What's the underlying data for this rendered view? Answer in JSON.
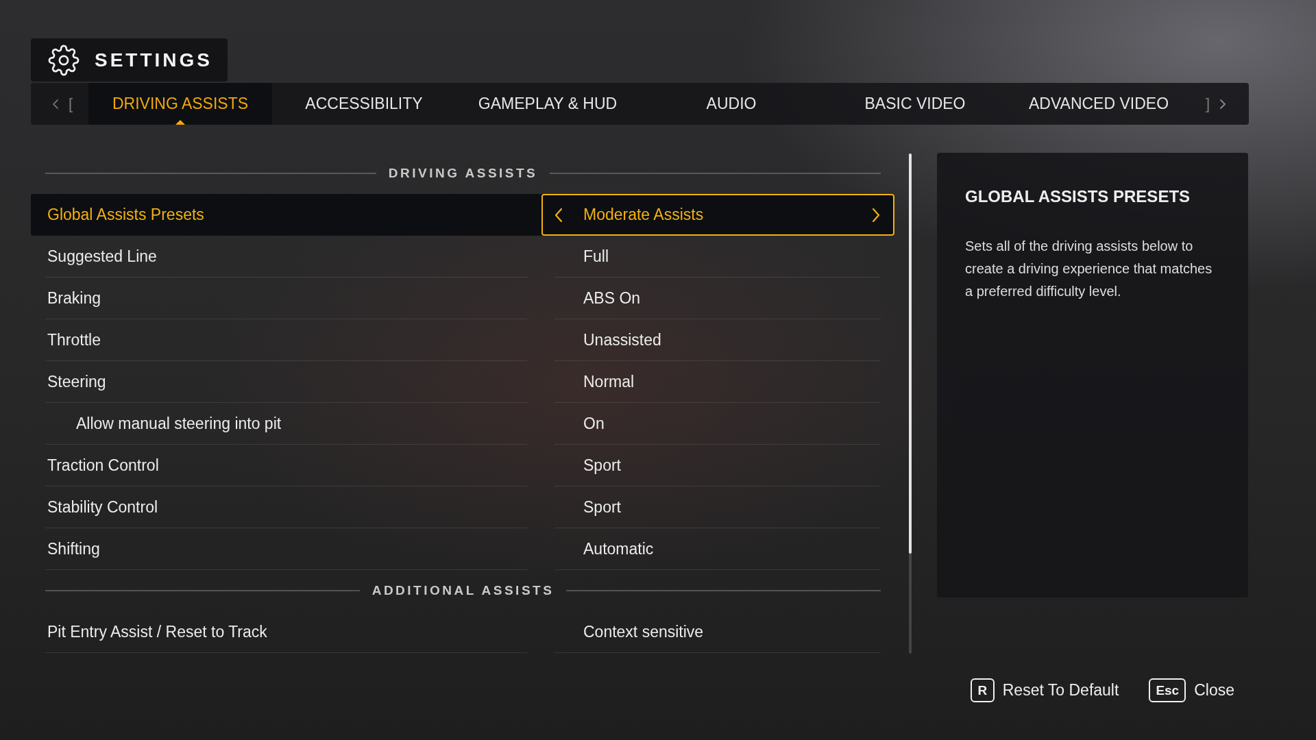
{
  "header": {
    "title": "SETTINGS"
  },
  "tab_bar": {
    "prev_key": "[",
    "next_key": "]",
    "tabs": [
      {
        "label": "DRIVING ASSISTS",
        "selected": true
      },
      {
        "label": "ACCESSIBILITY",
        "selected": false
      },
      {
        "label": "GAMEPLAY & HUD",
        "selected": false
      },
      {
        "label": "AUDIO",
        "selected": false
      },
      {
        "label": "BASIC VIDEO",
        "selected": false
      },
      {
        "label": "ADVANCED VIDEO",
        "selected": false
      }
    ]
  },
  "sections": [
    {
      "title": "DRIVING ASSISTS",
      "rows": [
        {
          "label": "Global Assists Presets",
          "value": "Moderate Assists",
          "selected": true
        },
        {
          "label": "Suggested Line",
          "value": "Full",
          "selected": false
        },
        {
          "label": "Braking",
          "value": "ABS On",
          "selected": false
        },
        {
          "label": "Throttle",
          "value": "Unassisted",
          "selected": false
        },
        {
          "label": "Steering",
          "value": "Normal",
          "selected": false,
          "children": [
            {
              "label": "Allow manual steering into pit",
              "value": "On",
              "selected": false
            }
          ]
        },
        {
          "label": "Traction Control",
          "value": "Sport",
          "selected": false
        },
        {
          "label": "Stability Control",
          "value": "Sport",
          "selected": false
        },
        {
          "label": "Shifting",
          "value": "Automatic",
          "selected": false
        }
      ]
    },
    {
      "title": "ADDITIONAL ASSISTS",
      "rows": [
        {
          "label": "Pit Entry Assist / Reset to Track",
          "value": "Context sensitive",
          "selected": false
        }
      ]
    }
  ],
  "detail_panel": {
    "title": "GLOBAL ASSISTS PRESETS",
    "description": "Sets all of the driving assists below to create a driving experience that matches a preferred difficulty level."
  },
  "footer_actions": [
    {
      "key": "R",
      "label": "Reset To Default"
    },
    {
      "key": "Esc",
      "label": "Close"
    }
  ]
}
